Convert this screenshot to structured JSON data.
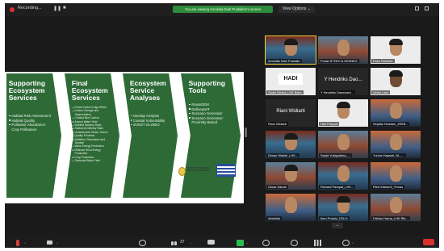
{
  "topbar": {
    "recording_label": "Recording...",
    "pause_symbol": "❚❚",
    "stop_symbol": "■",
    "banner_text": "You are viewing Annisitia Diah Puskaline's screen",
    "view_options": "View Options ⌄"
  },
  "slide": {
    "panels": [
      {
        "title": "Supporting Ecosystem Services",
        "items": [
          "Habitat Risk Assessment",
          "Habitat Quality",
          "Pollinator Abundance: Crop Pollination"
        ]
      },
      {
        "title": "Final Ecosystem Services",
        "items": [
          "Forest Carbon Edge Effect",
          "Carbon Storage and Sequestration",
          "Coastal Blue Carbon",
          "Annual Water Yield",
          "Nutrient Delivery Ratio",
          "Sediment Delivery Ratio",
          "Unobstructed Views: Scenic Quality Provision",
          "Visitation: Recreation and Tourism",
          "Wave Energy Production",
          "Offshore Wind Energy Production",
          "Crop Production",
          "Seasonal Water Yield"
        ]
      },
      {
        "title": "Ecosystem Service Analyses",
        "items": [
          "Overlap Analysis",
          "Coastal Vulnerability",
          "InVEST GLOBIO"
        ]
      },
      {
        "title": "Supporting Tools",
        "items": [
          "RouteDEM",
          "DelineateIT",
          "Scenario Generator",
          "Scenario Generator: Proximity Based"
        ]
      }
    ],
    "logo_text": "INSTITUT TEKNOLOGI SEPULUH NOPEMBER"
  },
  "gallery": {
    "tiles": [
      {
        "name": "Annisitia Diah Puskalin"
      },
      {
        "name": "Pusat JF EKO & KEANEG"
      },
      {
        "name": "Faza Fadhilah"
      },
      {
        "name": "Abdul Wahid_LHK Bahn"
      },
      {
        "name": "Y Hendriks Daomasel...",
        "center": "Y Hendriks Dao..."
      },
      {
        "name": "Athifa Laila"
      },
      {
        "name": "Riani Widiarti",
        "center": "Riani Widiarti"
      },
      {
        "name": "Hari Prayudi"
      },
      {
        "name": "Septian Mustam_JRKB..."
      },
      {
        "name": "Diman Wahidi_LHK..."
      },
      {
        "name": "Septa Yuliaputrina_..."
      },
      {
        "name": "Yunica Hapsari_NL_..."
      },
      {
        "name": "Oscar Kamal"
      },
      {
        "name": "Richard Parapat_LHK..."
      },
      {
        "name": "Rizki Mahardi_Temas"
      },
      {
        "name": "Abdullah"
      },
      {
        "name": "Ibnu Pratolo_DSLH"
      },
      {
        "name": "Fathan Harna_LHK Rib..."
      }
    ],
    "hadi_label": "HADI",
    "more_symbol": "⌄"
  },
  "toolbar": {
    "participants_count": "37",
    "caret": "^"
  }
}
